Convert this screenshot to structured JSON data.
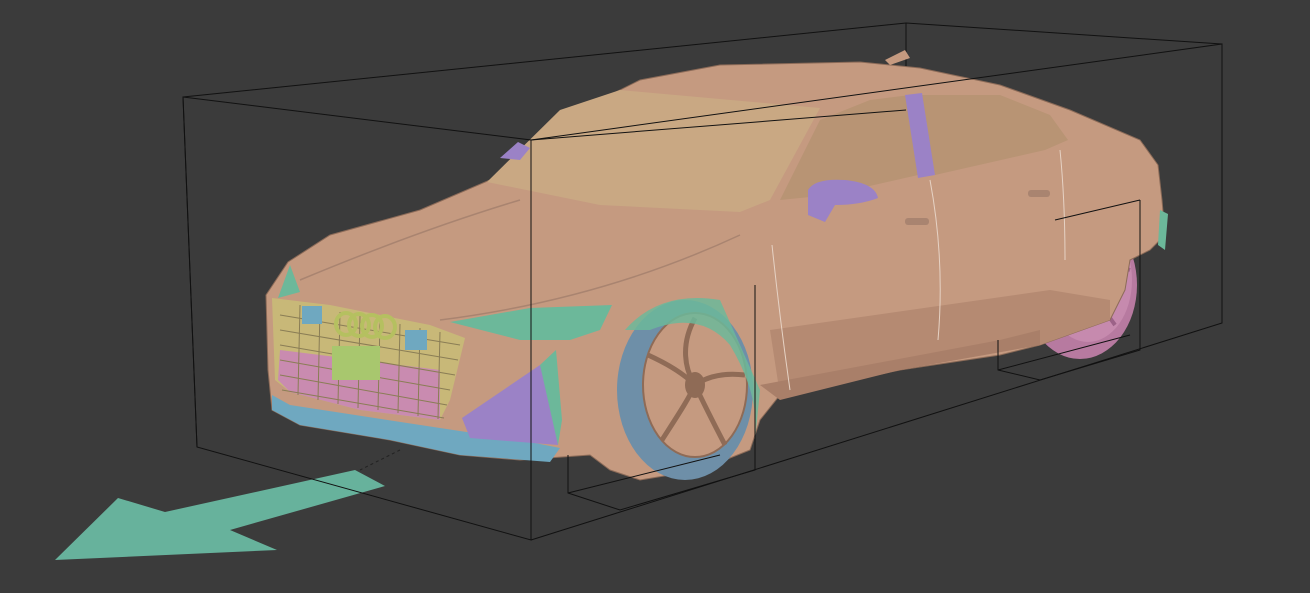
{
  "viewport": {
    "background": "#3b3b3b",
    "scene_object": "car-model",
    "brand_emblem": "four-rings-logo"
  },
  "colors": {
    "body": "#c59a80",
    "body_shadow": "#a97f69",
    "glass": "#c8a883",
    "trim_green": "#6cb89a",
    "trim_purple": "#9b82c6",
    "tire_blue": "#6e8fa8",
    "rim_pink": "#c68aae",
    "grille_pink": "#c98bb0",
    "grille_yellow": "#c8b878",
    "bbox_line": "#111111",
    "arrow": "#67b29c"
  },
  "gizmo": {
    "type": "direction-arrow",
    "direction": "front"
  }
}
